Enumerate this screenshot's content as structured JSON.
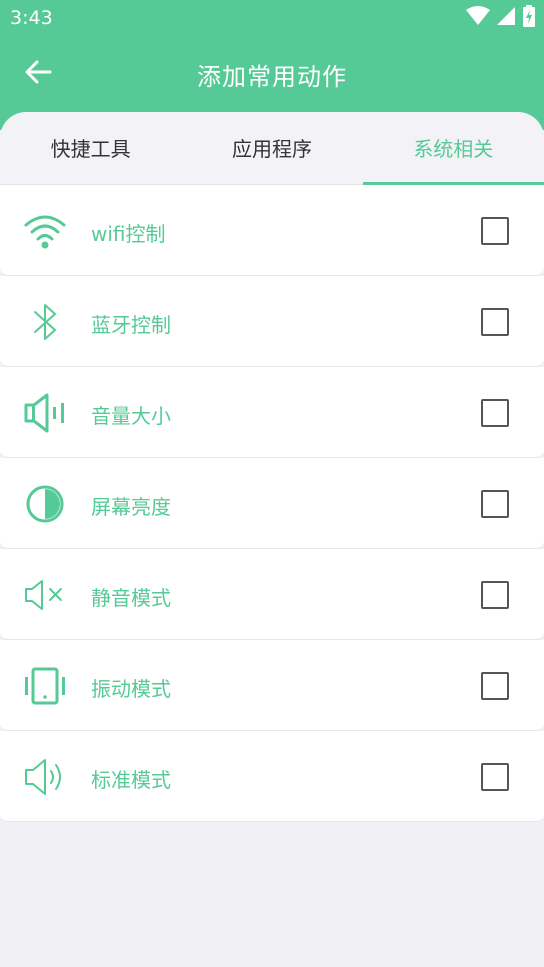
{
  "status_bar": {
    "time": "3:43",
    "icons": [
      "wifi-icon",
      "signal-icon",
      "battery-charging-icon"
    ]
  },
  "toolbar": {
    "back_icon": "arrow-left-icon",
    "title": "添加常用动作"
  },
  "tabs": [
    {
      "label": "快捷工具",
      "active": false
    },
    {
      "label": "应用程序",
      "active": false
    },
    {
      "label": "系统相关",
      "active": true
    }
  ],
  "items": [
    {
      "label": "wifi控制",
      "icon": "wifi-icon",
      "checked": false
    },
    {
      "label": "蓝牙控制",
      "icon": "bluetooth-icon",
      "checked": false
    },
    {
      "label": "音量大小",
      "icon": "volume-icon",
      "checked": false
    },
    {
      "label": "屏幕亮度",
      "icon": "brightness-icon",
      "checked": false
    },
    {
      "label": "静音模式",
      "icon": "mute-icon",
      "checked": false
    },
    {
      "label": "振动模式",
      "icon": "vibrate-icon",
      "checked": false
    },
    {
      "label": "标准模式",
      "icon": "sound-on-icon",
      "checked": false
    }
  ],
  "colors": {
    "accent": "#56ca96",
    "background": "#f0f0f5",
    "text": "#333333"
  }
}
